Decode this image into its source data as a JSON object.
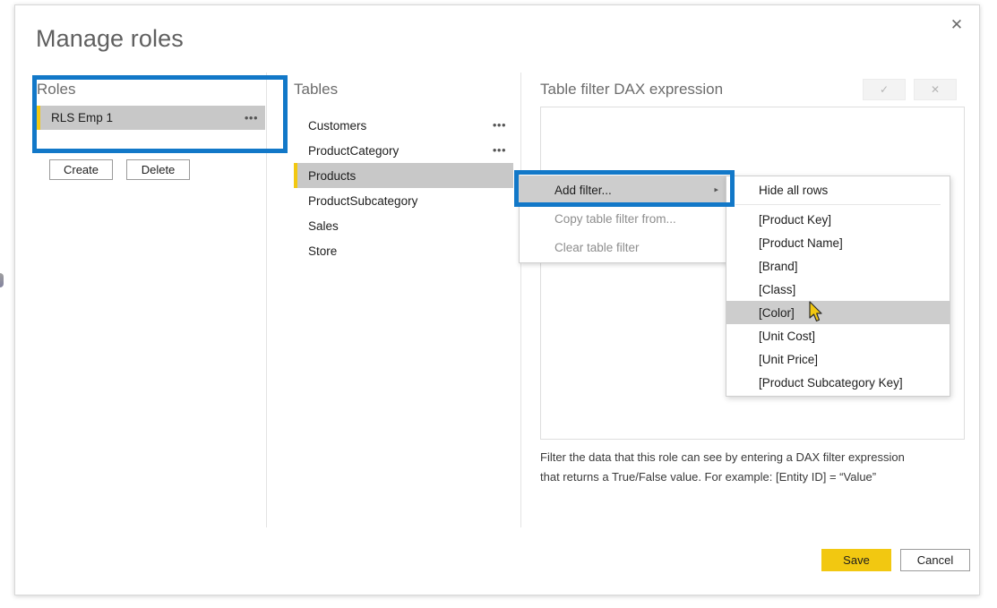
{
  "dialog": {
    "title": "Manage roles",
    "close_icon": "close-icon"
  },
  "roles_panel": {
    "heading": "Roles",
    "items": [
      {
        "label": "RLS Emp 1",
        "selected": true,
        "ellipsis": "…"
      }
    ],
    "create_label": "Create",
    "delete_label": "Delete"
  },
  "tables_panel": {
    "heading": "Tables",
    "items": [
      {
        "label": "Customers",
        "selected": false,
        "ellipsis": "…"
      },
      {
        "label": "ProductCategory",
        "selected": false,
        "ellipsis": "…"
      },
      {
        "label": "Products",
        "selected": true,
        "ellipsis": ""
      },
      {
        "label": "ProductSubcategory",
        "selected": false,
        "ellipsis": ""
      },
      {
        "label": "Sales",
        "selected": false,
        "ellipsis": ""
      },
      {
        "label": "Store",
        "selected": false,
        "ellipsis": ""
      }
    ]
  },
  "dax_panel": {
    "heading": "Table filter DAX expression",
    "accept_icon": "✓",
    "reject_icon": "✕",
    "expression_value": "",
    "help_line_1": "Filter the data that this role can see by entering a DAX filter expression",
    "help_line_2": "that returns a True/False value. For example: [Entity ID] = “Value”"
  },
  "context_menu": {
    "items": [
      {
        "label": "Add filter...",
        "enabled": true,
        "highlighted": true,
        "submenu_arrow": "▸"
      },
      {
        "label": "Copy table filter from...",
        "enabled": false,
        "highlighted": false,
        "submenu_arrow": ""
      },
      {
        "label": "Clear table filter",
        "enabled": false,
        "highlighted": false,
        "submenu_arrow": ""
      }
    ]
  },
  "submenu": {
    "items": [
      {
        "label": "Hide all rows",
        "highlighted": false
      },
      {
        "label": "[Product Key]",
        "highlighted": false
      },
      {
        "label": "[Product Name]",
        "highlighted": false
      },
      {
        "label": "[Brand]",
        "highlighted": false
      },
      {
        "label": "[Class]",
        "highlighted": false
      },
      {
        "label": "[Color]",
        "highlighted": true
      },
      {
        "label": "[Unit Cost]",
        "highlighted": false
      },
      {
        "label": "[Unit Price]",
        "highlighted": false
      },
      {
        "label": "[Product Subcategory Key]",
        "highlighted": false
      }
    ],
    "separator_after_index": 0
  },
  "footer": {
    "save_label": "Save",
    "cancel_label": "Cancel"
  },
  "colors": {
    "annotation_blue": "#1278c8",
    "accent_yellow": "#f2c811",
    "selection_gray": "#c8c8c8",
    "heading_gray": "#6c6c6c"
  }
}
